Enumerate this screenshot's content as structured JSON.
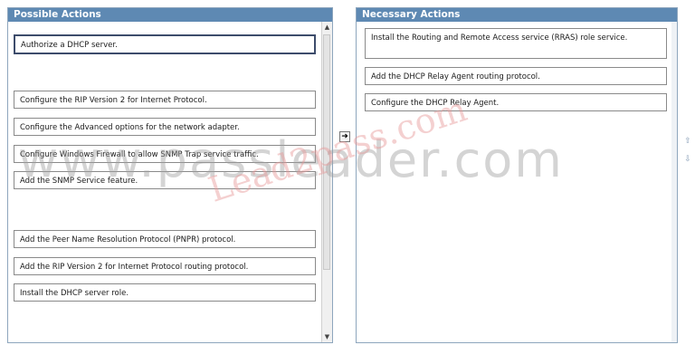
{
  "left_panel": {
    "title": "Possible Actions",
    "items": [
      "Authorize a DHCP server.",
      "Configure the RIP Version 2 for Internet Protocol.",
      "Configure the Advanced options for the network adapter.",
      "Configure Windows Firewall to allow SNMP Trap service traffic.",
      "Add the SNMP Service feature.",
      "Add the Peer Name Resolution Protocol (PNPR) protocol.",
      "Add the RIP Version 2 for Internet Protocol routing protocol.",
      "Install the DHCP server role."
    ]
  },
  "right_panel": {
    "title": "Necessary Actions",
    "items": [
      "Install the Routing and Remote Access service (RRAS) role service.",
      "Add the DHCP Relay Agent routing protocol.",
      "Configure the DHCP Relay Agent."
    ]
  },
  "controls": {
    "move_right": "➜",
    "move_up": "⇧",
    "move_down": "⇩",
    "scroll_up": "▲",
    "scroll_down": "▼"
  },
  "watermarks": {
    "main": "www.passleader.com",
    "secondary": "Lead2pass.com"
  }
}
